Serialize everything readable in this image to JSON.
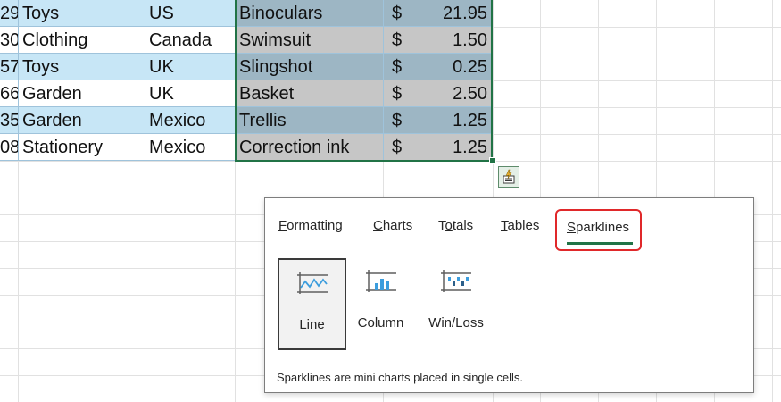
{
  "rows": [
    {
      "id": "29",
      "category": "Toys",
      "country": "US",
      "product": "Binoculars",
      "currency": "$",
      "amount": "21.95"
    },
    {
      "id": "30",
      "category": "Clothing",
      "country": "Canada",
      "product": "Swimsuit",
      "currency": "$",
      "amount": "1.50"
    },
    {
      "id": "57",
      "category": "Toys",
      "country": "UK",
      "product": "Slingshot",
      "currency": "$",
      "amount": "0.25"
    },
    {
      "id": "66",
      "category": "Garden",
      "country": "UK",
      "product": "Basket",
      "currency": "$",
      "amount": "2.50"
    },
    {
      "id": "35",
      "category": "Garden",
      "country": "Mexico",
      "product": "Trellis",
      "currency": "$",
      "amount": "1.25"
    },
    {
      "id": "08",
      "category": "Stationery",
      "country": "Mexico",
      "product": "Correction ink",
      "currency": "$",
      "amount": "1.25"
    }
  ],
  "quick_analysis": {
    "button_icon": "quick-analysis-icon",
    "tabs": [
      {
        "label": "Formatting",
        "underline_char": "F"
      },
      {
        "label": "Charts",
        "underline_char": "C"
      },
      {
        "label": "Totals",
        "underline_char": "o"
      },
      {
        "label": "Tables",
        "underline_char": "T"
      },
      {
        "label": "Sparklines",
        "underline_char": "S"
      }
    ],
    "active_tab": "Sparklines",
    "options": [
      {
        "label": "Line",
        "icon": "sparkline-line-icon",
        "selected": true
      },
      {
        "label": "Column",
        "icon": "sparkline-column-icon",
        "selected": false
      },
      {
        "label": "Win/Loss",
        "icon": "sparkline-winloss-icon",
        "selected": false
      }
    ],
    "description": "Sparklines are mini charts placed in single cells."
  },
  "colors": {
    "accent_green": "#217346",
    "highlight_red": "#e0282a",
    "band_blue": "#c7e6f6",
    "selected_band": "#9db6c4",
    "selected_gray": "#c6c6c6",
    "sparkline_blue": "#3c9ddd"
  }
}
